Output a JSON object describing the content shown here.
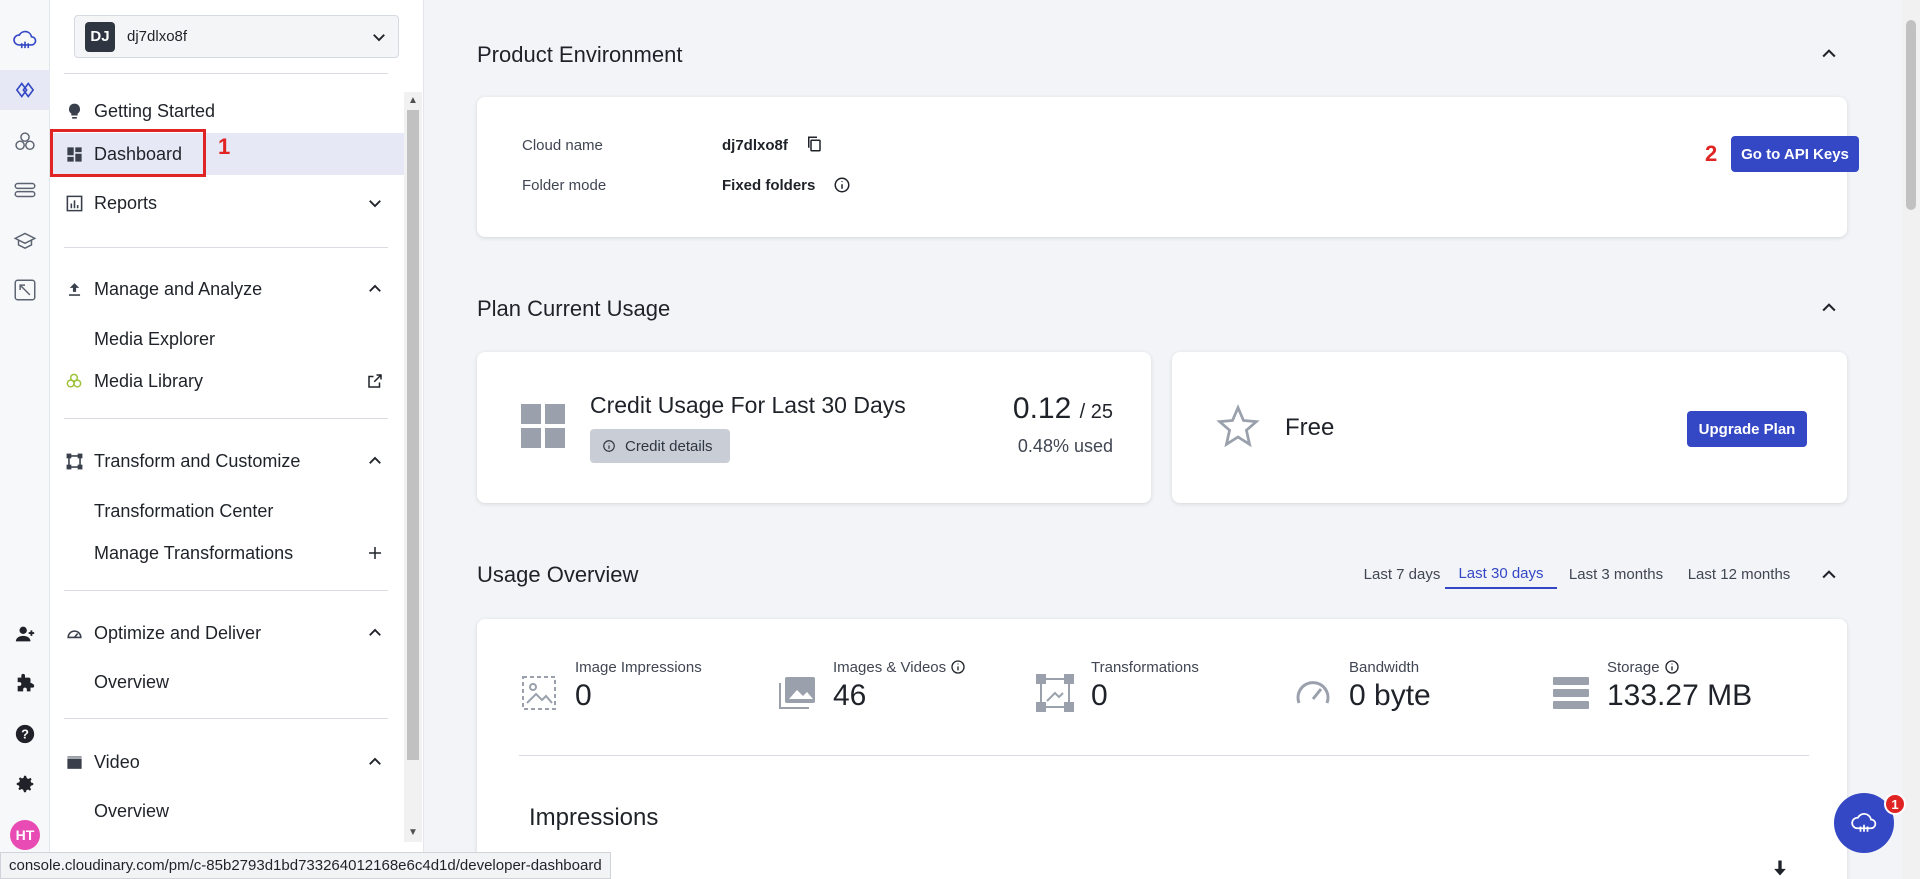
{
  "rail": {
    "icons": [
      "cloudinary-logo-icon",
      "developer-icon",
      "assets-icon",
      "pipeline-icon",
      "learn-icon",
      "tutorial-icon"
    ],
    "bottom_icons": [
      "add-user-icon",
      "extensions-icon",
      "help-icon",
      "settings-icon"
    ],
    "user_initials": "HT"
  },
  "env": {
    "initials": "DJ",
    "name": "dj7dlxo8f"
  },
  "nav": {
    "getting_started": "Getting Started",
    "dashboard": "Dashboard",
    "reports": "Reports",
    "manage_analyze": "Manage and Analyze",
    "media_explorer": "Media Explorer",
    "media_library": "Media Library",
    "transform_customize": "Transform and Customize",
    "transformation_center": "Transformation Center",
    "manage_transformations": "Manage Transformations",
    "optimize_deliver": "Optimize and Deliver",
    "optimize_overview": "Overview",
    "video": "Video",
    "video_overview": "Overview"
  },
  "annotations": {
    "marker_1": "1",
    "marker_2": "2"
  },
  "product_env": {
    "title": "Product Environment",
    "cloud_name_label": "Cloud name",
    "cloud_name_value": "dj7dlxo8f",
    "folder_mode_label": "Folder mode",
    "folder_mode_value": "Fixed folders",
    "api_keys_button": "Go to API Keys"
  },
  "plan_usage": {
    "title": "Plan Current Usage",
    "credit_title": "Credit Usage For Last 30 Days",
    "credit_details_button": "Credit details",
    "credit_used": "0.12",
    "credit_total": "/ 25",
    "credit_pct": "0.48% used",
    "plan_name": "Free",
    "upgrade_button": "Upgrade Plan"
  },
  "usage_overview": {
    "title": "Usage Overview",
    "ranges": [
      "Last 7 days",
      "Last 30 days",
      "Last 3 months",
      "Last 12 months"
    ],
    "active_range": "Last 30 days",
    "metrics": [
      {
        "label": "Image Impressions",
        "value": "0"
      },
      {
        "label": "Images & Videos",
        "value": "46"
      },
      {
        "label": "Transformations",
        "value": "0"
      },
      {
        "label": "Bandwidth",
        "value": "0 byte"
      },
      {
        "label": "Storage",
        "value": "133.27 MB"
      }
    ],
    "impressions_title": "Impressions"
  },
  "status_url": "console.cloudinary.com/pm/c-85b2793d1bd733264012168e6c4d1d/developer-dashboard",
  "chat": {
    "badge": "1"
  },
  "colors": {
    "accent": "#3448c5",
    "annotation_red": "#e02424",
    "active_nav_bg": "#e6e9f5"
  }
}
